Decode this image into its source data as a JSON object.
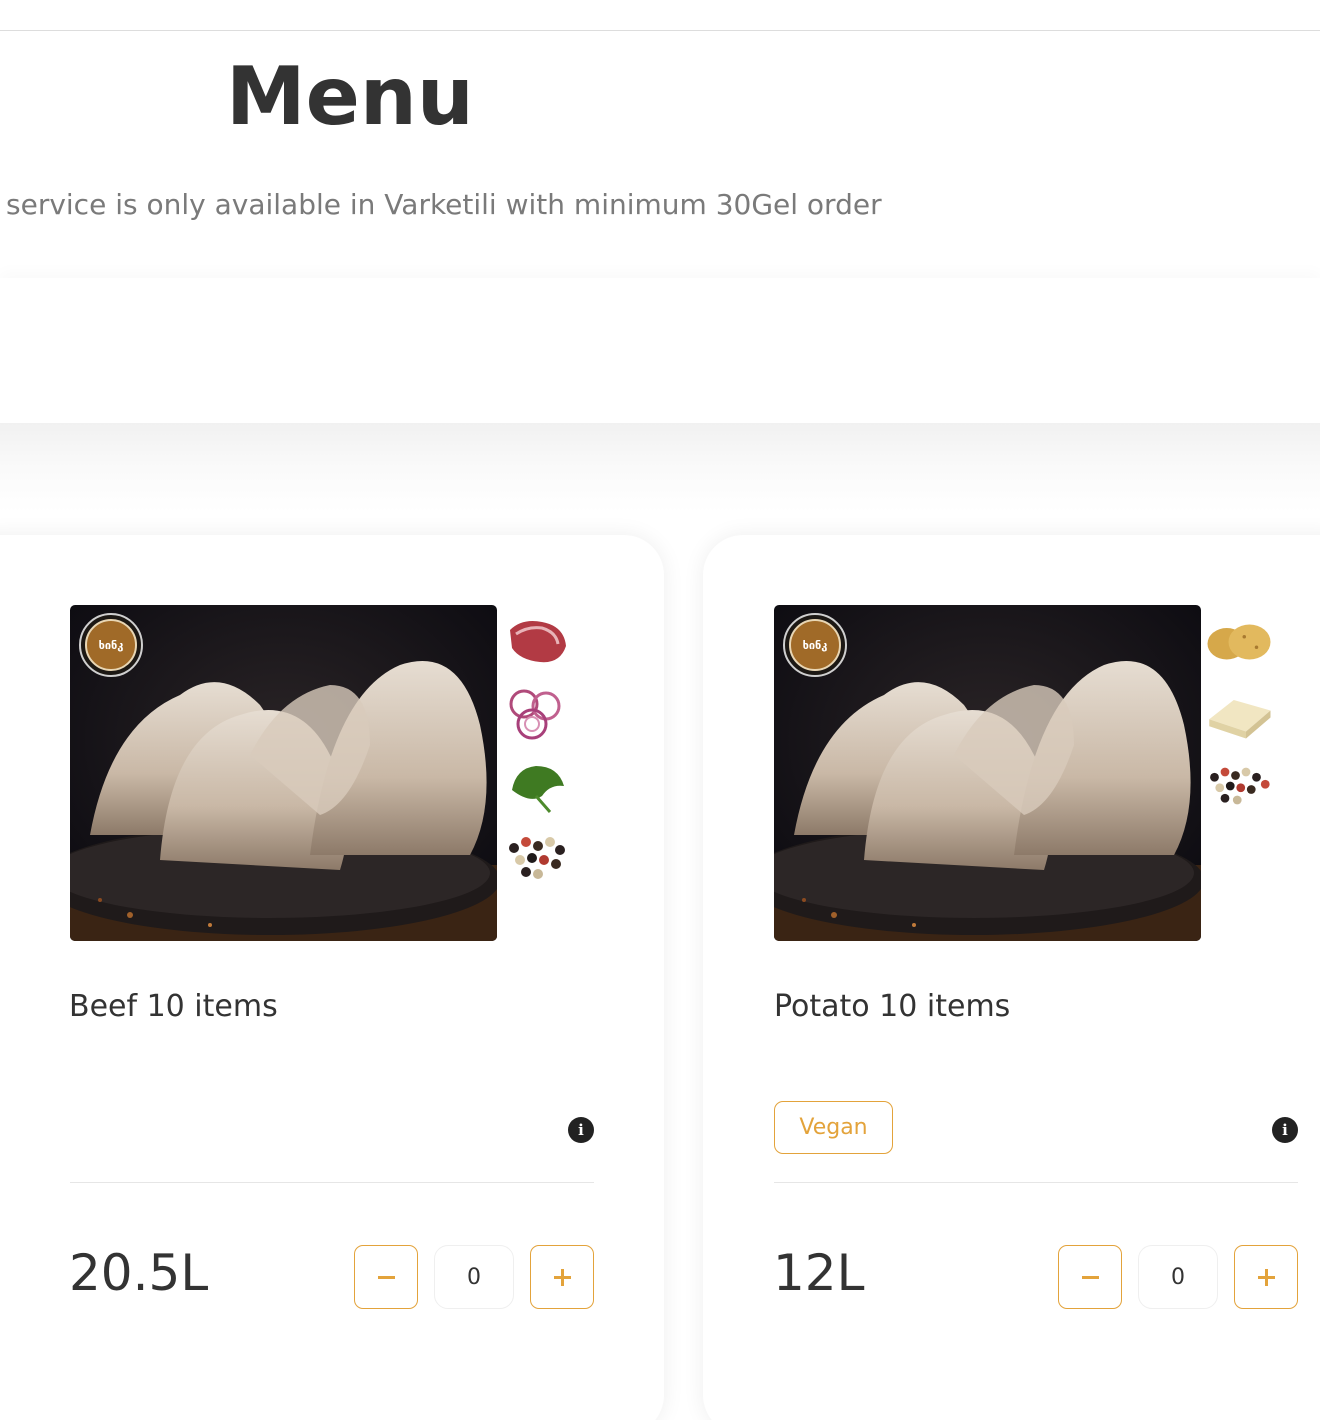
{
  "page": {
    "title": "Menu"
  },
  "notice": {
    "text": "service is only available in Varketili with minimum 30Gel order"
  },
  "colors": {
    "accent": "#e3a33b",
    "text": "#333333",
    "muted": "#7a7a7a"
  },
  "products": [
    {
      "name": "Beef 10 items",
      "price": "20.5L",
      "quantity": "0",
      "tags": [],
      "logo_text": "ხინკ",
      "ingredients": [
        "beef-icon",
        "onion-icon",
        "cilantro-icon",
        "peppercorn-icon"
      ]
    },
    {
      "name": "Potato 10 items",
      "price": "12L",
      "quantity": "0",
      "tags": [
        "Vegan"
      ],
      "logo_text": "ხინკ",
      "ingredients": [
        "potato-icon",
        "butter-icon",
        "peppercorn-icon"
      ]
    }
  ],
  "icons": {
    "info": "i",
    "minus": "minus-icon",
    "plus": "plus-icon"
  }
}
